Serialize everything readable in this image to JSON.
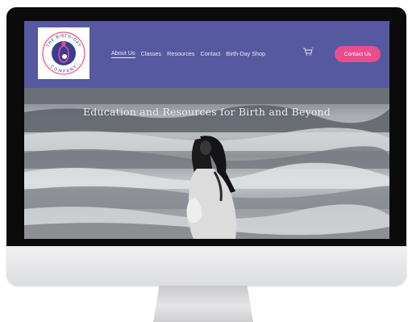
{
  "site": {
    "logo": {
      "top_text": "THE BIRTH-DAY",
      "bottom_text": "COMPANY",
      "icon": "pregnant-figure-logo-icon"
    },
    "nav": {
      "items": [
        {
          "label": "About Us",
          "active": true
        },
        {
          "label": "Classes",
          "active": false
        },
        {
          "label": "Resources",
          "active": false
        },
        {
          "label": "Contact",
          "active": false
        },
        {
          "label": "Birth-Day Shop",
          "active": false
        }
      ],
      "cart_icon": "shopping-cart-icon",
      "cart_count": "0",
      "contact_button": "Contact Us"
    },
    "hero": {
      "headline": "Education and Resources for Birth and Beyond",
      "image": "pregnant-woman-on-beach"
    }
  },
  "colors": {
    "navbar": "#5659a0",
    "button": "#e94e8c",
    "logo_ring": "#e94e8c",
    "logo_fill": "#3a3d8f"
  }
}
